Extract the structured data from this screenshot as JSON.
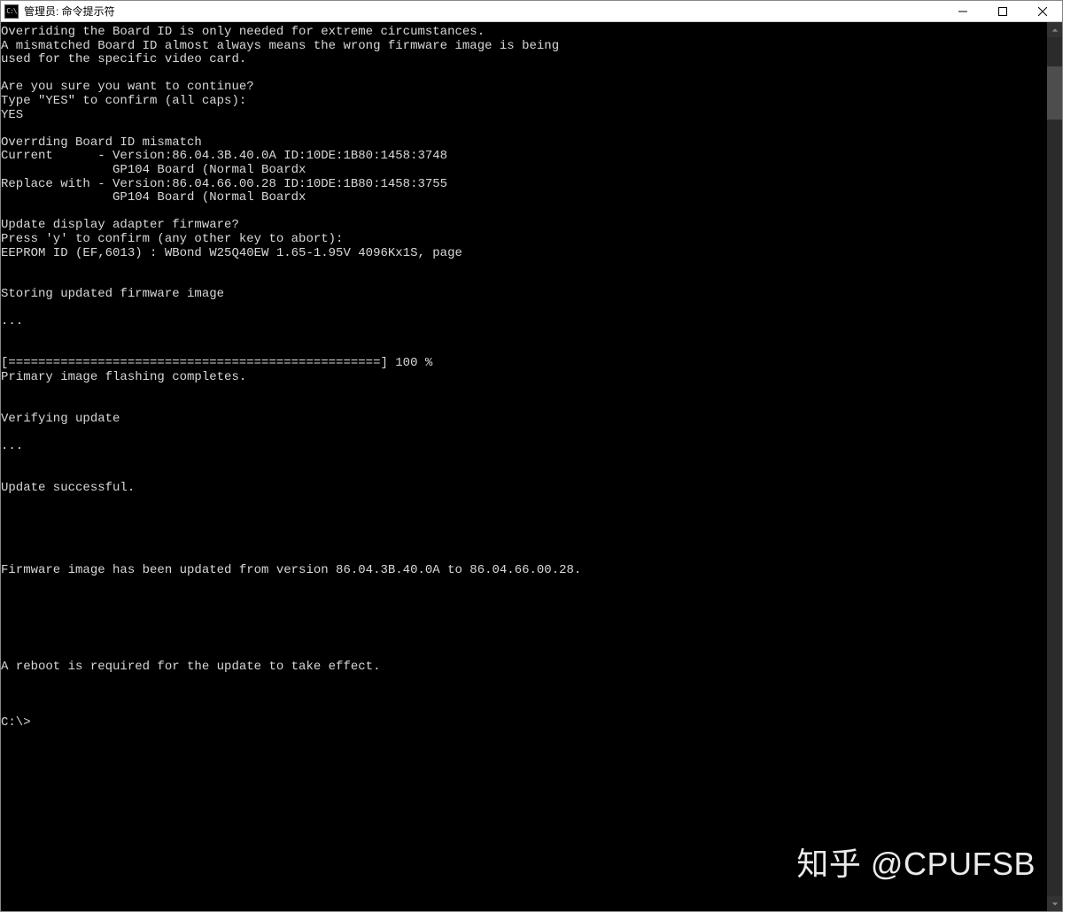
{
  "window": {
    "title": "管理员: 命令提示符",
    "icon_label": "cmd-icon"
  },
  "terminal": {
    "lines": [
      "Overriding the Board ID is only needed for extreme circumstances.",
      "A mismatched Board ID almost always means the wrong firmware image is being",
      "used for the specific video card.",
      "",
      "Are you sure you want to continue?",
      "Type \"YES\" to confirm (all caps):",
      "YES",
      "",
      "Overrding Board ID mismatch",
      "Current      - Version:86.04.3B.40.0A ID:10DE:1B80:1458:3748",
      "               GP104 Board (Normal Boardx",
      "Replace with - Version:86.04.66.00.28 ID:10DE:1B80:1458:3755",
      "               GP104 Board (Normal Boardx",
      "",
      "Update display adapter firmware?",
      "Press 'y' to confirm (any other key to abort):",
      "EEPROM ID (EF,6013) : WBond W25Q40EW 1.65-1.95V 4096Kx1S, page",
      "",
      "",
      "Storing updated firmware image",
      "",
      "...",
      "",
      "",
      "[==================================================] 100 %",
      "Primary image flashing completes.",
      "",
      "",
      "Verifying update",
      "",
      "...",
      "",
      "",
      "Update successful.",
      "",
      "",
      "",
      "",
      "",
      "Firmware image has been updated from version 86.04.3B.40.0A to 86.04.66.00.28.",
      "",
      "",
      "",
      "",
      "",
      "",
      "A reboot is required for the update to take effect.",
      "",
      "",
      "",
      "C:\\>"
    ]
  },
  "watermark": "知乎 @CPUFSB"
}
